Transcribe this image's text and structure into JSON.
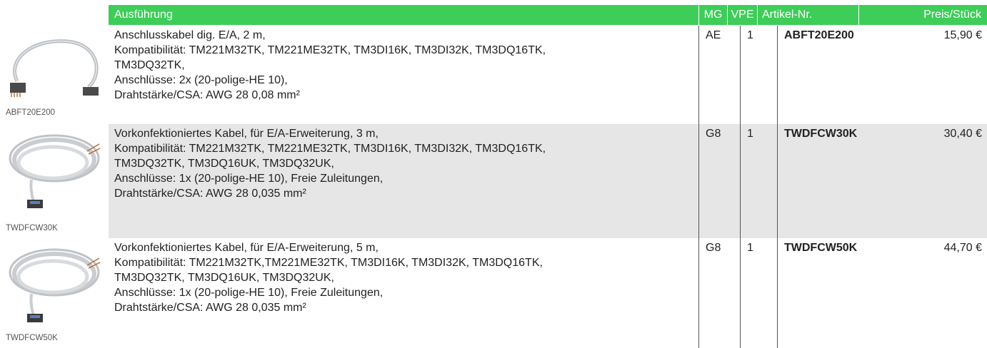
{
  "header": {
    "columns": [
      "Ausführung",
      "MG",
      "VPE",
      "Artikel-Nr.",
      "Preis/Stück"
    ]
  },
  "rows": [
    {
      "image_caption": "ABFT20E200",
      "description": [
        "Anschlusskabel dig. E/A, 2 m,",
        "Kompatibilität: TM221M32TK, TM221ME32TK, TM3DI16K, TM3DI32K, TM3DQ16TK,",
        "TM3DQ32TK,",
        "Anschlüsse: 2x (20-polige-HE 10),",
        "Drahtstärke/CSA: AWG 28 0,08 mm²"
      ],
      "mg": "AE",
      "vpe": "1",
      "article": "ABFT20E200",
      "price": "15,90 €"
    },
    {
      "image_caption": "TWDFCW30K",
      "description": [
        "Vorkonfektioniertes Kabel, für E/A-Erweiterung, 3 m,",
        "Kompatibilität: TM221M32TK, TM221ME32TK, TM3DI16K, TM3DI32K, TM3DQ16TK,",
        "TM3DQ32TK, TM3DQ16UK, TM3DQ32UK,",
        "Anschlüsse: 1x (20-polige-HE 10), Freie Zuleitungen,",
        "Drahtstärke/CSA: AWG 28 0,035 mm²"
      ],
      "mg": "G8",
      "vpe": "1",
      "article": "TWDFCW30K",
      "price": "30,40 €"
    },
    {
      "image_caption": "TWDFCW50K",
      "description": [
        "Vorkonfektioniertes Kabel, für E/A-Erweiterung, 5 m,",
        "Kompatibilität: TM221M32TK,TM221ME32TK, TM3DI16K, TM3DI32K, TM3DQ16TK,",
        "TM3DQ32TK, TM3DQ16UK, TM3DQ32UK,",
        "Anschlüsse: 1x (20-polige-HE 10), Freie Zuleitungen,",
        "Drahtstärke/CSA: AWG 28 0,035 mm²"
      ],
      "mg": "G8",
      "vpe": "1",
      "article": "TWDFCW50K",
      "price": "44,70 €"
    }
  ],
  "colors": {
    "header_bg": "#3dcd58",
    "header_text": "#ffffff",
    "row_shade": "#e6e6e6"
  }
}
